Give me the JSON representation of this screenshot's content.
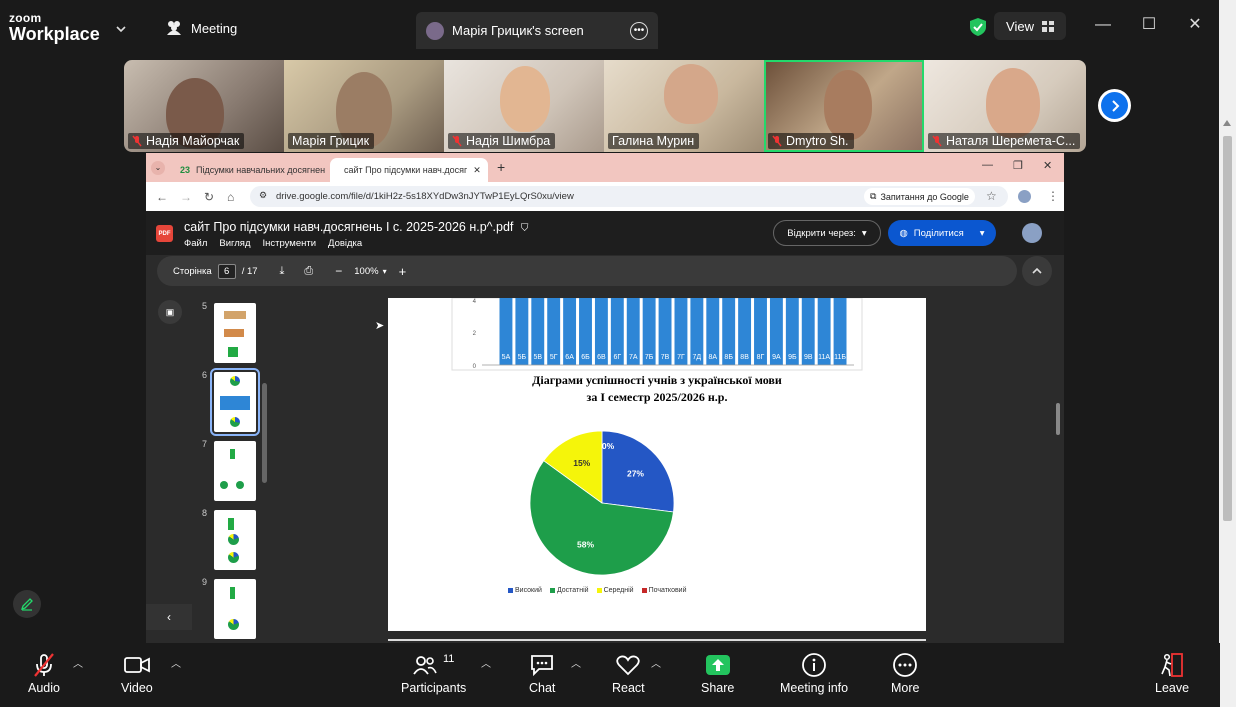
{
  "topbar": {
    "logo_small": "zoom",
    "logo_big": "Workplace",
    "meeting_label": "Meeting",
    "shared_tab_label": "Марія Грицик's screen",
    "view_label": "View"
  },
  "gallery": {
    "participants": [
      {
        "name": "Надія Майорчак",
        "muted": true
      },
      {
        "name": "Марія Грицик",
        "muted": false
      },
      {
        "name": "Надія Шимбра",
        "muted": true
      },
      {
        "name": "Галина Мурин",
        "muted": false
      },
      {
        "name": "Dmytro Sh.",
        "muted": true,
        "active_speaker": true
      },
      {
        "name": "Наталя Шеремета-С...",
        "muted": true
      }
    ]
  },
  "browser": {
    "tabs": [
      {
        "label": "Підсумки навчальних досягнен",
        "badge": "23"
      },
      {
        "label": "сайт Про підсумки навч.досяг"
      }
    ],
    "url": "drive.google.com/file/d/1kiH2z-5s18XYdDw3nJYTwP1EyLQrS0xu/view",
    "ask_google": "Запитання до Google"
  },
  "doc": {
    "title": "сайт Про підсумки навч.досягнень І с. 2025-2026 н.р^.pdf",
    "menu": [
      "Файл",
      "Вигляд",
      "Інструменти",
      "Довідка"
    ],
    "open_with": "Відкрити через:",
    "share": "Поділитися",
    "page_label": "Сторінка",
    "page_current": "6",
    "page_total": "/ 17",
    "zoom": "100%"
  },
  "thumbnails": [
    {
      "num": "5"
    },
    {
      "num": "6",
      "selected": true
    },
    {
      "num": "7"
    },
    {
      "num": "8"
    },
    {
      "num": "9"
    }
  ],
  "page": {
    "bar_y_ticks": [
      "4",
      "2",
      "0"
    ],
    "bar_classes": [
      "5А",
      "5Б",
      "5В",
      "5Г",
      "6А",
      "6Б",
      "6В",
      "6Г",
      "7А",
      "7Б",
      "7В",
      "7Г",
      "7Д",
      "8А",
      "8Б",
      "8В",
      "8Г",
      "9А",
      "9Б",
      "9В",
      "11А",
      "11Б"
    ],
    "pie_title_1": "Діаграми успішності учнів з української мови",
    "pie_title_2": "за І семестр 2025/2026 н.р."
  },
  "chart_data": {
    "type": "pie",
    "categories": [
      "Високий",
      "Достатній",
      "Середній",
      "Початковий"
    ],
    "values": [
      27,
      58,
      15,
      0
    ],
    "labels": [
      "27%",
      "58%",
      "15%",
      "0%"
    ],
    "colors": [
      "#2457c5",
      "#1e9e4a",
      "#f5f50a",
      "#c62828"
    ],
    "title": "Діаграми успішності учнів з української мови за І семестр 2025/2026 н.р.",
    "legend": "bottom"
  },
  "bottombar": {
    "audio": "Audio",
    "video": "Video",
    "participants": "Participants",
    "participants_count": "11",
    "chat": "Chat",
    "react": "React",
    "share": "Share",
    "meeting_info": "Meeting info",
    "more": "More",
    "leave": "Leave"
  }
}
